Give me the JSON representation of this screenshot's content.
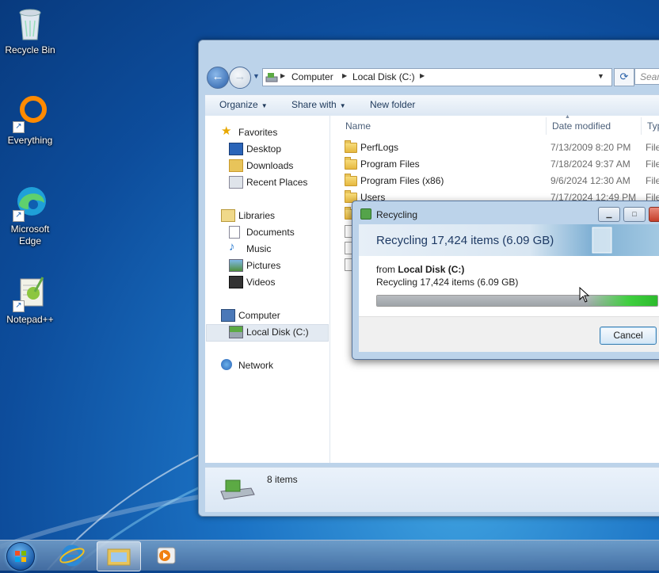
{
  "desktop": {
    "icons": [
      {
        "label": "Recycle Bin"
      },
      {
        "label": "Everything"
      },
      {
        "label": "Microsoft Edge"
      },
      {
        "label": "Notepad++"
      }
    ]
  },
  "explorer": {
    "breadcrumb": [
      "Computer",
      "Local Disk (C:)"
    ],
    "search_placeholder": "Search",
    "toolbar": {
      "organize": "Organize",
      "share_with": "Share with",
      "new_folder": "New folder"
    },
    "nav": {
      "favorites": "Favorites",
      "desktop": "Desktop",
      "downloads": "Downloads",
      "recent_places": "Recent Places",
      "libraries": "Libraries",
      "documents": "Documents",
      "music": "Music",
      "pictures": "Pictures",
      "videos": "Videos",
      "computer": "Computer",
      "local_disk": "Local Disk (C:)",
      "network": "Network"
    },
    "columns": {
      "name": "Name",
      "date_modified": "Date modified",
      "type": "Typ"
    },
    "files": [
      {
        "name": "PerfLogs",
        "date": "7/13/2009 8:20 PM",
        "type": "File"
      },
      {
        "name": "Program Files",
        "date": "7/18/2024 9:37 AM",
        "type": "File"
      },
      {
        "name": "Program Files (x86)",
        "date": "9/6/2024 12:30 AM",
        "type": "File"
      },
      {
        "name": "Users",
        "date": "7/17/2024 12:49 PM",
        "type": "File"
      }
    ],
    "status": "8 items"
  },
  "dialog": {
    "title": "Recycling",
    "heading": "Recycling 17,424 items (6.09 GB)",
    "from_prefix": "from",
    "from_location": "Local Disk (C:)",
    "progress_text": "Recycling 17,424 items (6.09 GB)",
    "progress_fraction": 0.99,
    "cancel_label": "Cancel"
  },
  "colors": {
    "accent": "#1b72c4",
    "progress_green": "#3fcf3f"
  }
}
